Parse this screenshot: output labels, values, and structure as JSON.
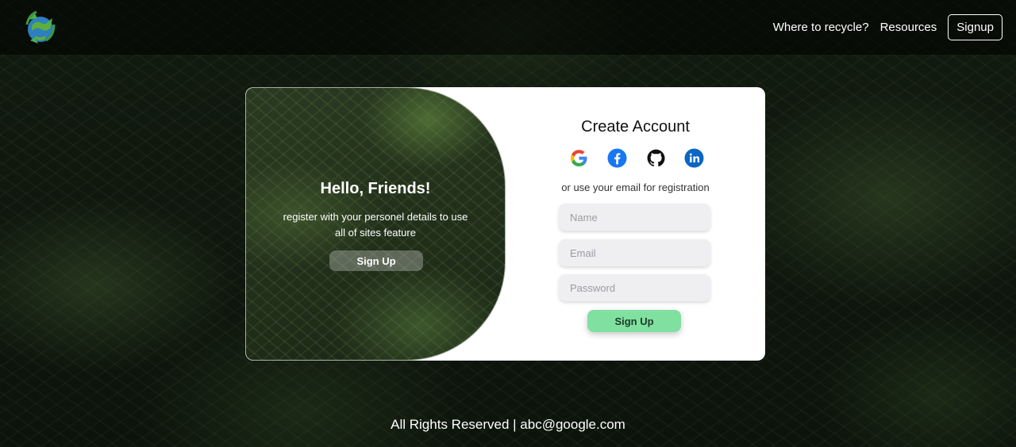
{
  "header": {
    "logo_icon": "recycle-globe-logo",
    "nav": [
      {
        "label": "Where to recycle?"
      },
      {
        "label": "Resources"
      }
    ],
    "signup_label": "Signup"
  },
  "overlay": {
    "title": "Hello, Friends!",
    "text": "register with your personel details to use all of sites feature",
    "button_label": "Sign Up"
  },
  "form": {
    "title": "Create Account",
    "socials": [
      {
        "icon": "google-icon",
        "color": "#4285F4"
      },
      {
        "icon": "facebook-icon",
        "color": "#1877F2"
      },
      {
        "icon": "github-icon",
        "color": "#000000"
      },
      {
        "icon": "linkedin-icon",
        "color": "#0A66C2"
      }
    ],
    "subtitle": "or use your email for registration",
    "name_placeholder": "Name",
    "email_placeholder": "Email",
    "password_placeholder": "Password",
    "submit_label": "Sign Up",
    "submit_color": "#7fe0a0"
  },
  "footer": {
    "text": "All Rights Reserved | abc@google.com"
  }
}
